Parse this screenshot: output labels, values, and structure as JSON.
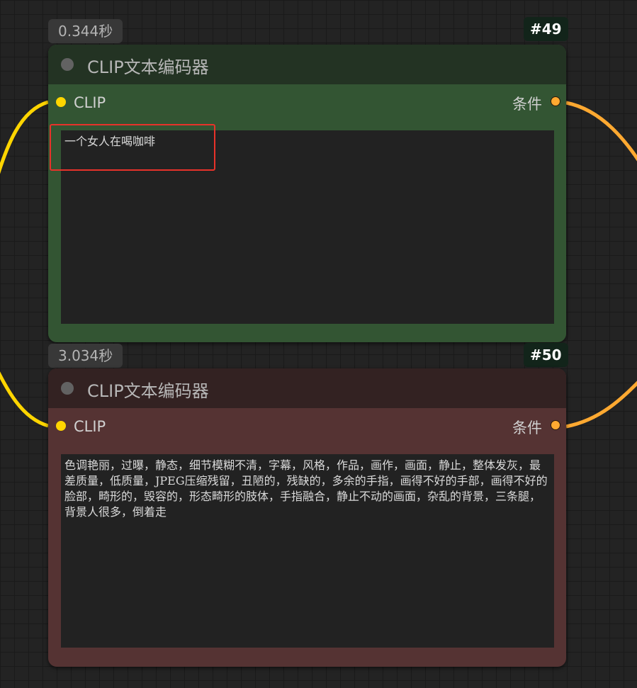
{
  "nodes": [
    {
      "id": "#49",
      "exec_time": "0.344秒",
      "title": "CLIP文本编码器",
      "input_label": "CLIP",
      "output_label": "条件",
      "text": "一个女人在喝咖啡"
    },
    {
      "id": "#50",
      "exec_time": "3.034秒",
      "title": "CLIP文本编码器",
      "input_label": "CLIP",
      "output_label": "条件",
      "text": "色调艳丽，过曝，静态，细节模糊不清，字幕，风格，作品，画作，画面，静止，整体发灰，最差质量，低质量，JPEG压缩残留，丑陋的，残缺的，多余的手指，画得不好的手部，画得不好的脸部，畸形的，毁容的，形态畸形的肢体，手指融合，静止不动的画面，杂乱的背景，三条腿，背景人很多，倒着走"
    }
  ],
  "colors": {
    "canvas_bg": "#232323",
    "positive_node_header": "#233323",
    "positive_node_body": "#335533",
    "negative_node_header": "#332222",
    "negative_node_body": "#553333",
    "clip_link": "#ffd500",
    "conditioning_link": "#ffa931",
    "highlight": "#e8322a"
  }
}
